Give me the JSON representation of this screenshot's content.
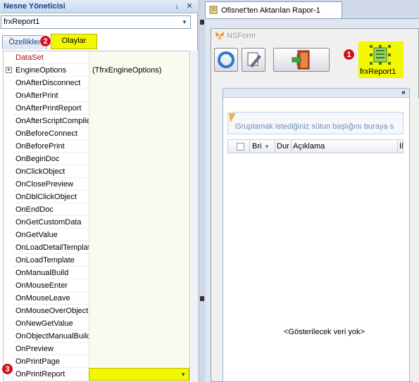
{
  "left_panel": {
    "title": "Nesne Yöneticisi",
    "pin_glyph": "↓",
    "close_glyph": "✕",
    "object_select": {
      "value": "frxReport1"
    },
    "tabs": [
      {
        "label": "Özellikler"
      },
      {
        "label": "Olaylar"
      }
    ],
    "badge_2": "2",
    "badge_3": "3",
    "rows": [
      {
        "name": "DataSet",
        "value": "",
        "kind": "category"
      },
      {
        "name": "EngineOptions",
        "value": "(TfrxEngineOptions)",
        "kind": "expandable"
      },
      {
        "name": "OnAfterDisconnect",
        "value": ""
      },
      {
        "name": "OnAfterPrint",
        "value": ""
      },
      {
        "name": "OnAfterPrintReport",
        "value": ""
      },
      {
        "name": "OnAfterScriptCompile",
        "value": ""
      },
      {
        "name": "OnBeforeConnect",
        "value": ""
      },
      {
        "name": "OnBeforePrint",
        "value": ""
      },
      {
        "name": "OnBeginDoc",
        "value": ""
      },
      {
        "name": "OnClickObject",
        "value": ""
      },
      {
        "name": "OnClosePreview",
        "value": ""
      },
      {
        "name": "OnDblClickObject",
        "value": ""
      },
      {
        "name": "OnEndDoc",
        "value": ""
      },
      {
        "name": "OnGetCustomData",
        "value": ""
      },
      {
        "name": "OnGetValue",
        "value": ""
      },
      {
        "name": "OnLoadDetailTemplate",
        "value": ""
      },
      {
        "name": "OnLoadTemplate",
        "value": ""
      },
      {
        "name": "OnManualBuild",
        "value": ""
      },
      {
        "name": "OnMouseEnter",
        "value": ""
      },
      {
        "name": "OnMouseLeave",
        "value": ""
      },
      {
        "name": "OnMouseOverObject",
        "value": ""
      },
      {
        "name": "OnNewGetValue",
        "value": ""
      },
      {
        "name": "OnObjectManualBuild",
        "value": ""
      },
      {
        "name": "OnPreview",
        "value": ""
      },
      {
        "name": "OnPrintPage",
        "value": ""
      },
      {
        "name": "OnPrintReport",
        "value": "",
        "kind": "selected"
      }
    ]
  },
  "document": {
    "tab_title": "Ofisnet'ten Aktarılan Rapor-1",
    "form_title": "NSForm",
    "component_label": "frxReport1",
    "badge_1": "1",
    "collapse_glyph": "«",
    "group_hint": "Gruplamak istediğiniz sütun başlığını buraya s",
    "columns": [
      "Bri",
      "Dur",
      "Açıklama",
      "İl"
    ],
    "empty_text": "<Gösterilecek veri yok>"
  },
  "colors": {
    "highlight": "#f3f700",
    "badge_red": "#d0121b",
    "category_text": "#9c1010",
    "header_text": "#15428b"
  },
  "icons": [
    "pin-icon",
    "close-icon",
    "chevron-down-icon",
    "refresh-icon",
    "tools-icon",
    "exit-door-icon",
    "report-component-icon",
    "form-logo-icon",
    "document-icon",
    "filter-icon"
  ]
}
